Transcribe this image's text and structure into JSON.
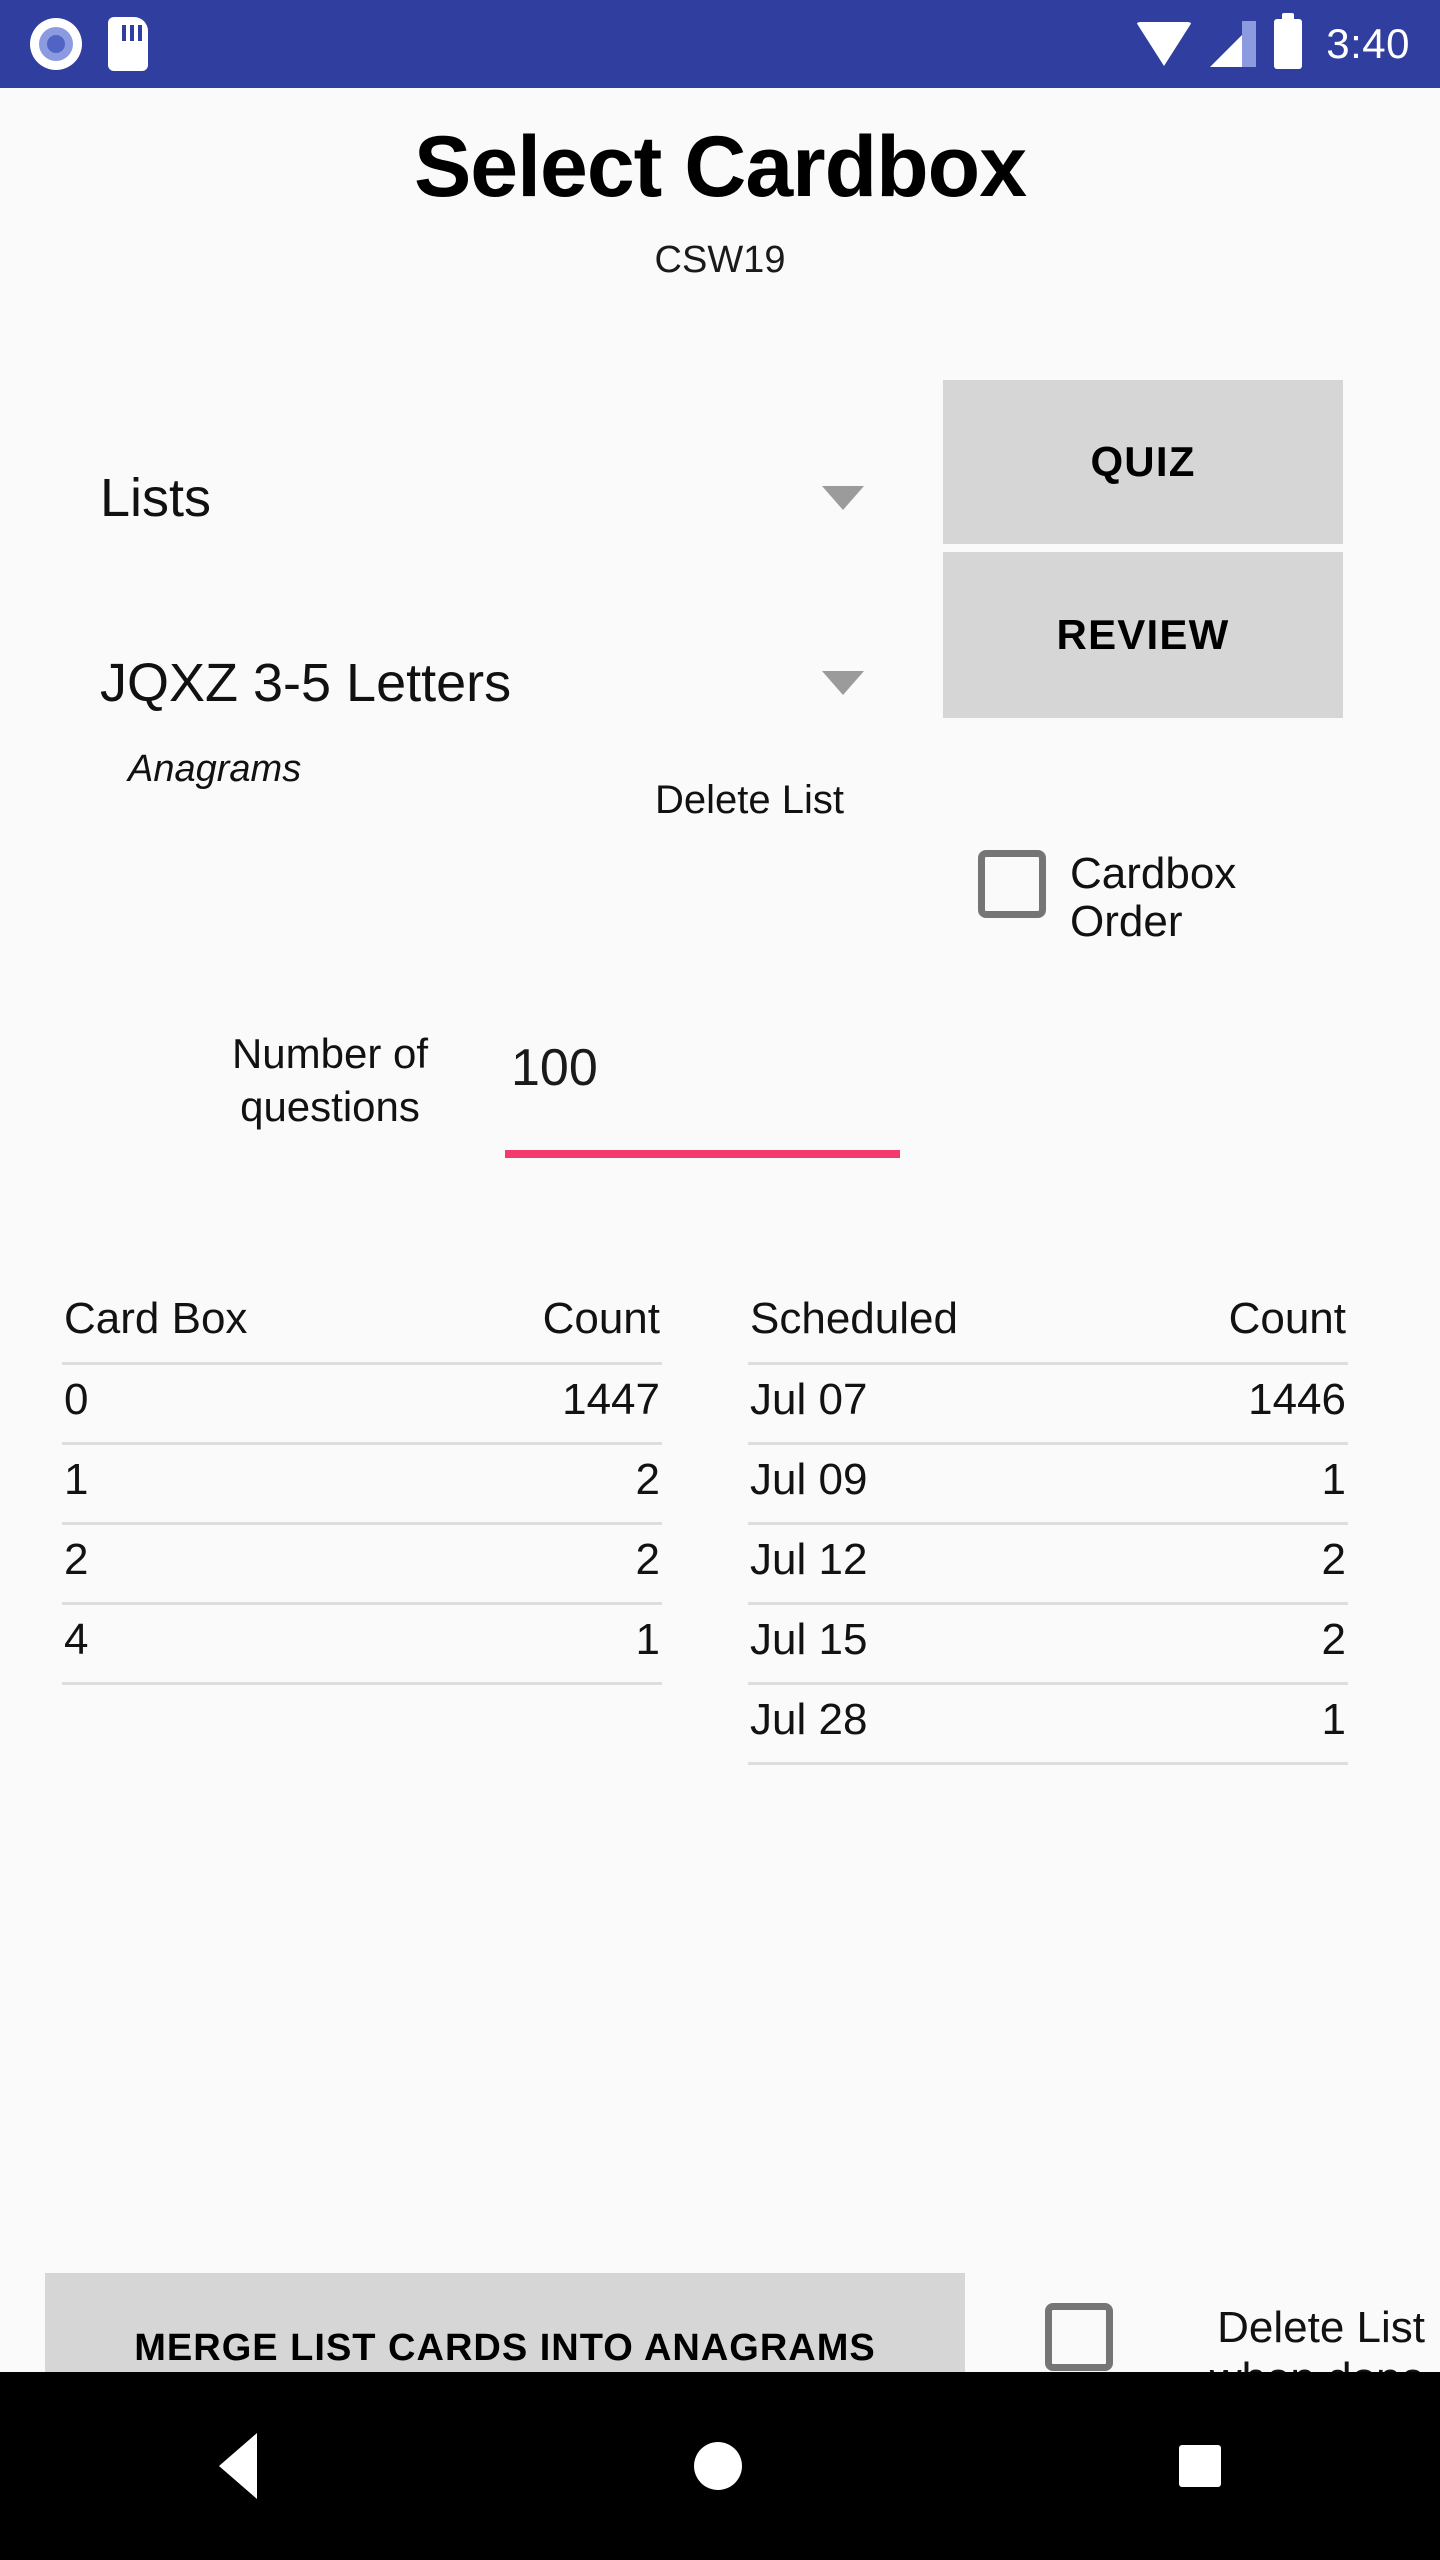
{
  "status_bar": {
    "time": "3:40",
    "left_icons": [
      "screen-record-icon",
      "sd-card-icon"
    ],
    "right_icons": [
      "wifi-icon",
      "signal-icon",
      "battery-icon"
    ],
    "background_color": "#303f9f"
  },
  "header": {
    "title": "Select Cardbox",
    "subtitle": "CSW19"
  },
  "controls": {
    "list_type_spinner": "Lists",
    "list_name_spinner": "JQXZ 3-5 Letters",
    "quiz_button": "QUIZ",
    "review_button": "REVIEW",
    "anagrams_label": "Anagrams",
    "delete_list_text": "Delete List",
    "cardbox_order_label": "Cardbox Order",
    "cardbox_order_checked": false,
    "number_of_questions_label": "Number of questions",
    "number_of_questions_value": "100",
    "accent_color": "#f4396e",
    "button_color": "#d6d6d6"
  },
  "cardbox_table": {
    "headers": [
      "Card Box",
      "Count"
    ],
    "rows": [
      {
        "key": "0",
        "value": "1447"
      },
      {
        "key": "1",
        "value": "2"
      },
      {
        "key": "2",
        "value": "2"
      },
      {
        "key": "4",
        "value": "1"
      }
    ]
  },
  "scheduled_table": {
    "headers": [
      "Scheduled",
      "Count"
    ],
    "rows": [
      {
        "key": "Jul 07",
        "value": "1446"
      },
      {
        "key": "Jul 09",
        "value": "1"
      },
      {
        "key": "Jul 12",
        "value": "2"
      },
      {
        "key": "Jul 15",
        "value": "2"
      },
      {
        "key": "Jul 28",
        "value": "1"
      }
    ]
  },
  "footer": {
    "merge_button": "MERGE LIST CARDS INTO ANAGRAMS",
    "delete_when_done_label": "Delete List when done",
    "delete_when_done_checked": false
  },
  "nav_bar": {
    "back": "back-icon",
    "home": "home-icon",
    "recents": "recents-icon"
  }
}
